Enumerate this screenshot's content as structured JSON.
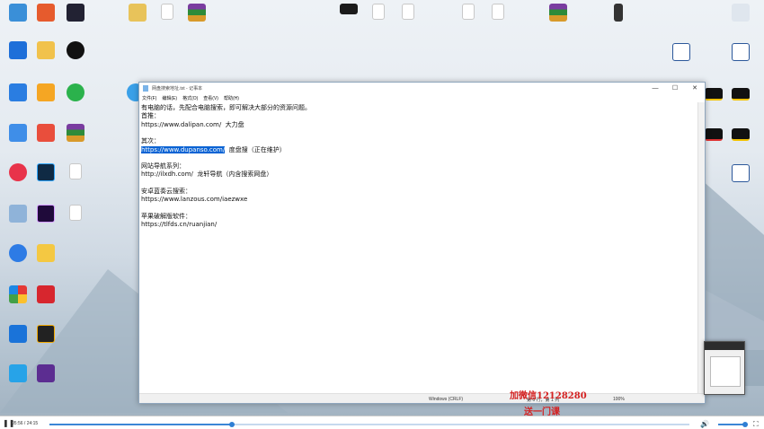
{
  "notepad": {
    "title": "网盘搜索地址.txt - 记事本",
    "menu": [
      "文件(F)",
      "编辑(E)",
      "格式(O)",
      "查看(V)",
      "帮助(H)"
    ],
    "lines": [
      "有电脑的话，先配合电脑搜索，即可解决大部分的资源问题。",
      "首推：",
      "https://www.dalipan.com/  大力盘",
      "",
      "其次：",
      "SELECTED",
      "",
      "网站导航系列：",
      "http://ilxdh.com/  龙轩导航（内含搜索网盘）",
      "",
      "安卓蓝奏云搜索：",
      "https://www.lanzous.com/iaezwxe",
      "",
      "苹果破解版软件：",
      "https://tlfds.cn/ruanjian/"
    ],
    "selected_url": "https://www.dupanso.com/",
    "selected_suffix": "  度盘搜（正在维护）",
    "status": {
      "encoding": "Windows (CRLF)",
      "position": "第 6 行，第 1 列",
      "zoom": "100%"
    },
    "controls": {
      "minimize": "—",
      "maximize": "☐",
      "close": "✕"
    }
  },
  "watermark": {
    "line1": "加微信12128280",
    "line2": "送一门课"
  },
  "player": {
    "current": "05:56",
    "total": "24:15",
    "progress": 0.285,
    "volume": 0.9
  }
}
